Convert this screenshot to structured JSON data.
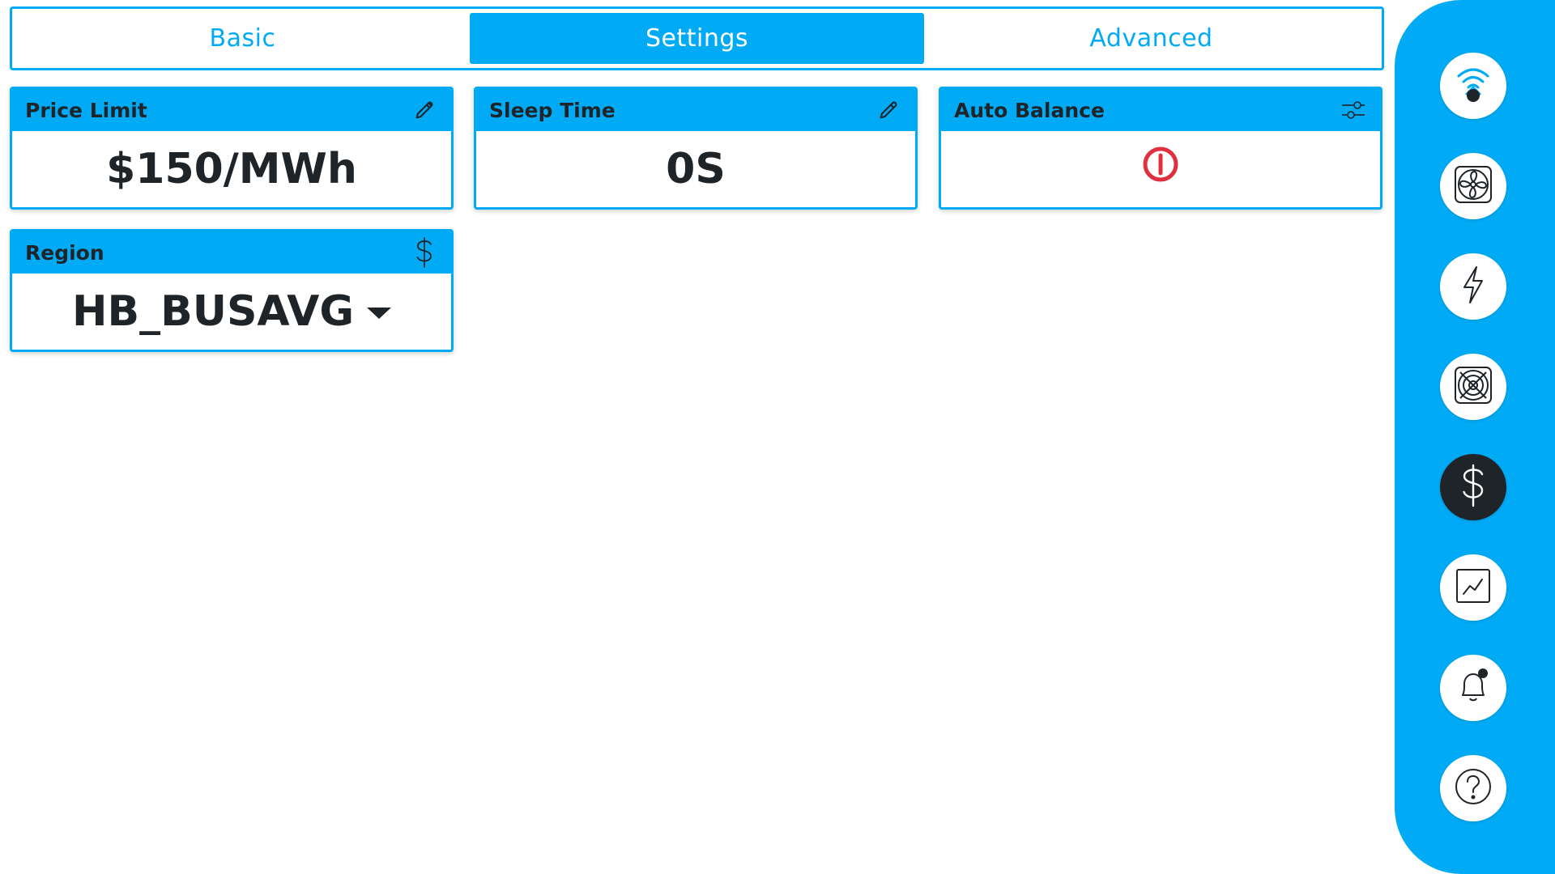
{
  "colors": {
    "accent": "#00aaf5",
    "dark": "#1f2429",
    "power_off": "#e0303e"
  },
  "tabs": [
    {
      "label": "Basic",
      "active": false
    },
    {
      "label": "Settings",
      "active": true
    },
    {
      "label": "Advanced",
      "active": false
    }
  ],
  "cards": {
    "price_limit": {
      "title": "Price Limit",
      "value": "$150/MWh",
      "icon": "pencil-icon"
    },
    "sleep_time": {
      "title": "Sleep Time",
      "value": "0S",
      "icon": "pencil-icon"
    },
    "auto_balance": {
      "title": "Auto Balance",
      "value_icon": "power-off-icon",
      "icon": "sliders-icon"
    },
    "region": {
      "title": "Region",
      "value": "HB_BUSAVG",
      "icon": "dollar-icon"
    }
  },
  "sidebar": {
    "items": [
      {
        "name": "wifi-device-icon",
        "active": false
      },
      {
        "name": "fan-icon",
        "active": false
      },
      {
        "name": "lightning-icon",
        "active": false
      },
      {
        "name": "fan-grill-icon",
        "active": false
      },
      {
        "name": "dollar-icon",
        "active": true
      },
      {
        "name": "chart-icon",
        "active": false
      },
      {
        "name": "bell-notification-icon",
        "active": false
      },
      {
        "name": "help-icon",
        "active": false
      }
    ]
  }
}
